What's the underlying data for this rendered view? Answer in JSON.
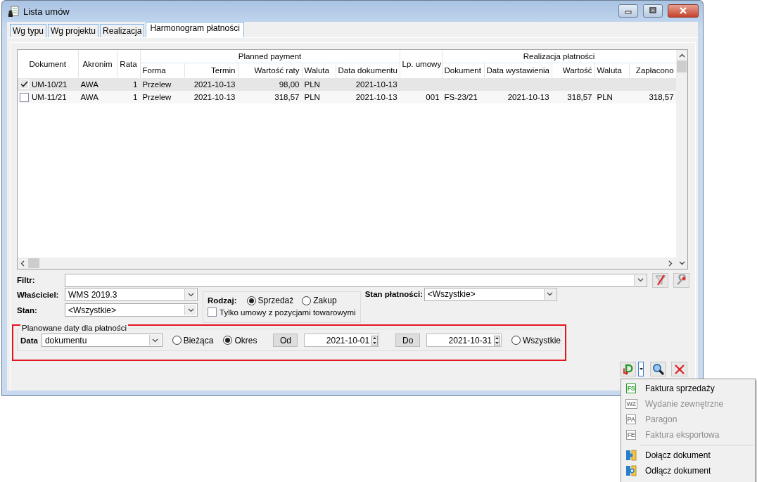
{
  "window": {
    "title": "Lista umów"
  },
  "tabs": [
    {
      "label": "Wg typu",
      "selected": false
    },
    {
      "label": "Wg projektu",
      "selected": false
    },
    {
      "label": "Realizacja",
      "selected": false
    },
    {
      "label": "Harmonogram płatności",
      "selected": true
    }
  ],
  "table": {
    "groups": [
      {
        "label": "Planned payment"
      },
      {
        "label": "Realizacja płatności"
      }
    ],
    "columns": [
      {
        "label": "Dokument"
      },
      {
        "label": "Akronim"
      },
      {
        "label": "Rata"
      },
      {
        "label": "Forma"
      },
      {
        "label": "Termin"
      },
      {
        "label": "Wartość raty"
      },
      {
        "label": "Waluta"
      },
      {
        "label": "Data dokumentu"
      },
      {
        "label": "Lp. umowy"
      },
      {
        "label": "Dokument"
      },
      {
        "label": "Data wystawienia"
      },
      {
        "label": "Wartość"
      },
      {
        "label": "Waluta"
      },
      {
        "label": "Zapłacono"
      }
    ],
    "rows": [
      {
        "checked": true,
        "selected": true,
        "cells": [
          "UM-10/21",
          "AWA",
          "1",
          "Przelew",
          "2021-10-13",
          "98,00",
          "PLN",
          "2021-10-13",
          null,
          null,
          null,
          null,
          null,
          null
        ]
      },
      {
        "checked": false,
        "selected": false,
        "cells": [
          "UM-11/21",
          "AWA",
          "1",
          "Przelew",
          "2021-10-13",
          "318,57",
          "PLN",
          "2021-10-13",
          "001",
          "FS-23/21",
          "2021-10-13",
          "318,57",
          "PLN",
          "318,57"
        ]
      }
    ]
  },
  "filter": {
    "label": "Filtr:"
  },
  "owner": {
    "label": "Właściciel:",
    "value": "WMS 2019.3"
  },
  "state": {
    "label": "Stan:",
    "value": "<Wszystkie>"
  },
  "kind_group": {
    "label": "Rodzaj:",
    "options": [
      {
        "label": "Sprzedaż",
        "selected": true
      },
      {
        "label": "Zakup",
        "selected": false
      }
    ],
    "only_goods": {
      "label": "Tylko umowy z pozycjami towarowymi",
      "checked": false
    }
  },
  "payment_state": {
    "label": "Stan płatności:",
    "value": "<Wszystkie>"
  },
  "planned_dates": {
    "title": "Planowane daty dla płatności",
    "date_label": "Data",
    "date_value": "dokumentu",
    "options": [
      {
        "label": "Bieżąca",
        "selected": false
      },
      {
        "label": "Okres",
        "selected": true
      }
    ],
    "from_button": "Od",
    "from_value": "2021-10-01",
    "to_button": "Do",
    "to_value": "2021-10-31",
    "all_option": {
      "label": "Wszystkie",
      "selected": false
    }
  },
  "menu": [
    {
      "kind": "doc",
      "code": "FS",
      "label": "Faktura sprzedaży",
      "disabled": false
    },
    {
      "kind": "doc",
      "code": "WZ",
      "label": "Wydanie zewnętrzne",
      "disabled": true
    },
    {
      "kind": "doc",
      "code": "PA",
      "label": "Paragon",
      "disabled": true
    },
    {
      "kind": "doc",
      "code": "FE",
      "label": "Faktura eksportowa",
      "disabled": true
    },
    {
      "kind": "separator"
    },
    {
      "kind": "attach",
      "label": "Dołącz dokument",
      "disabled": false
    },
    {
      "kind": "detach",
      "label": "Odłącz dokument",
      "disabled": false
    }
  ]
}
